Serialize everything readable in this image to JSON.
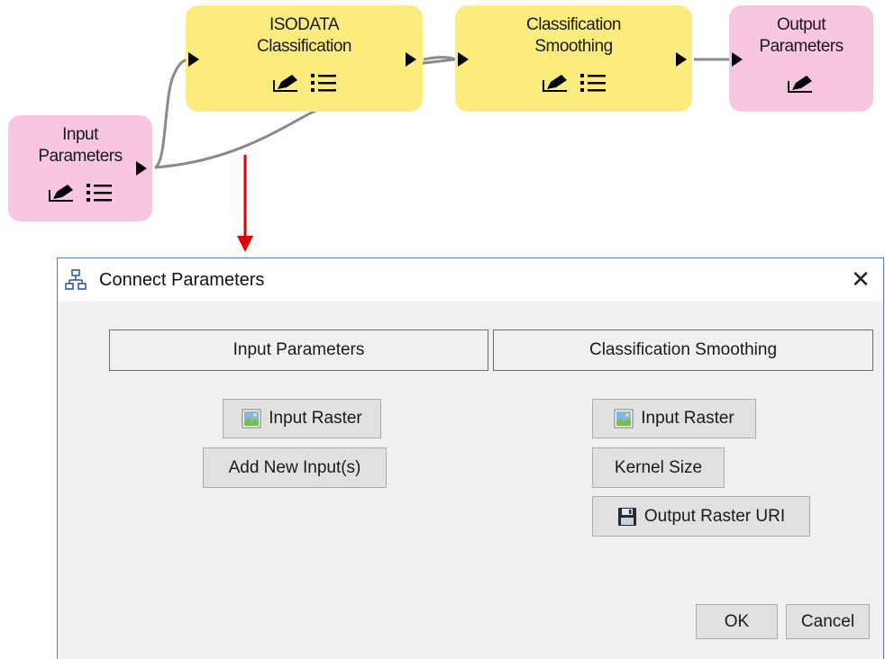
{
  "workflow": {
    "nodes": {
      "input_parameters": {
        "label_line1": "Input",
        "label_line2": "Parameters"
      },
      "isodata": {
        "label_line1": "ISODATA",
        "label_line2": "Classification"
      },
      "smoothing": {
        "label_line1": "Classification",
        "label_line2": "Smoothing"
      },
      "output_parameters": {
        "label_line1": "Output",
        "label_line2": "Parameters"
      }
    },
    "colors": {
      "task_node": "#fbec7d",
      "param_node": "#f8c6e0",
      "link": "#808080",
      "arrow": "#e00000"
    }
  },
  "dialog": {
    "title": "Connect Parameters",
    "close_icon": "close-icon",
    "left_header": "Input Parameters",
    "right_header": "Classification Smoothing",
    "left_buttons": {
      "input_raster": "Input Raster",
      "add_new_inputs": "Add New Input(s)"
    },
    "right_buttons": {
      "input_raster": "Input Raster",
      "kernel_size": "Kernel Size",
      "output_raster_uri": "Output Raster URI"
    },
    "ok_label": "OK",
    "cancel_label": "Cancel"
  }
}
